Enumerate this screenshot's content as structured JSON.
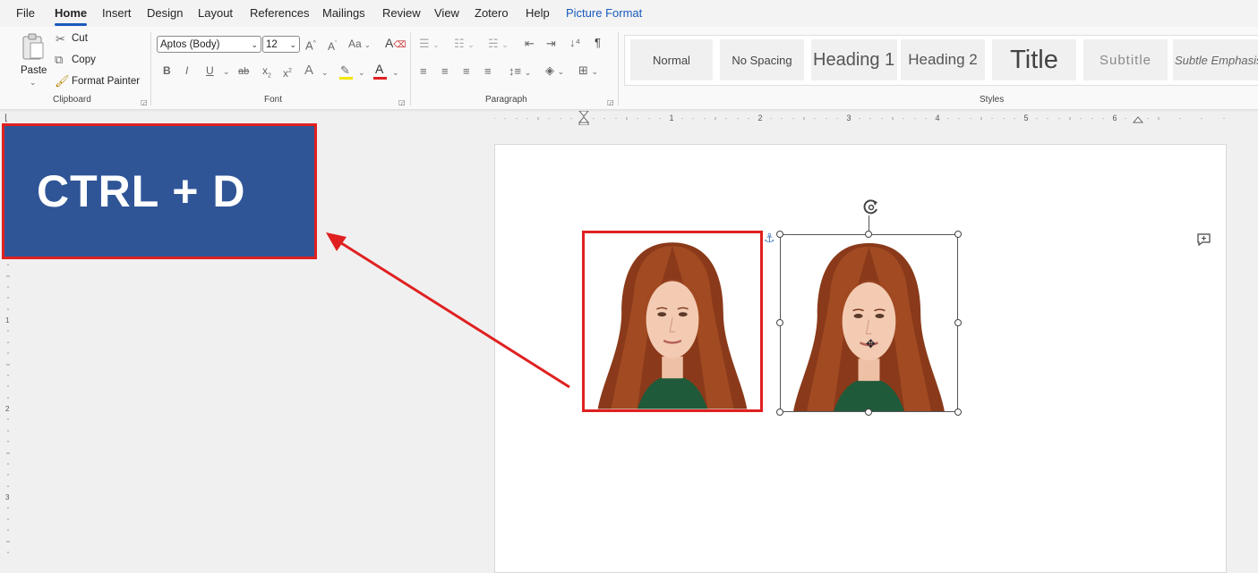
{
  "menu": {
    "file": "File",
    "home": "Home",
    "insert": "Insert",
    "design": "Design",
    "layout": "Layout",
    "references": "References",
    "mailings": "Mailings",
    "review": "Review",
    "view": "View",
    "zotero": "Zotero",
    "help": "Help",
    "picture_format": "Picture Format"
  },
  "clipboard": {
    "paste": "Paste",
    "cut": "Cut",
    "copy": "Copy",
    "format_painter": "Format Painter",
    "label": "Clipboard"
  },
  "font": {
    "family": "Aptos (Body)",
    "size": "12",
    "label": "Font",
    "grow": "A",
    "shrink": "A",
    "change_case": "Aa",
    "bold": "B",
    "italic": "I",
    "underline": "U",
    "strike": "ab",
    "subscript": "x",
    "subscript_mark": "2",
    "superscript": "x",
    "superscript_mark": "2",
    "text_effects": "A",
    "font_color": "A",
    "font_color_value": "#e02020",
    "highlight_color_value": "#f2e600"
  },
  "paragraph": {
    "label": "Paragraph",
    "show_marks": "¶"
  },
  "styles": {
    "label": "Styles",
    "items": [
      "Normal",
      "No Spacing",
      "Heading 1",
      "Heading 2",
      "Title",
      "Subtitle",
      "Subtle Emphasis"
    ]
  },
  "ruler": {
    "numbers": [
      "1",
      "2",
      "3",
      "4",
      "5",
      "6"
    ],
    "vertical_numbers": [
      "1",
      "2",
      "3"
    ]
  },
  "callout": {
    "text": "CTRL + D",
    "bg_color": "#2f5597",
    "border_color": "#e02020"
  },
  "accent": "#185abd"
}
